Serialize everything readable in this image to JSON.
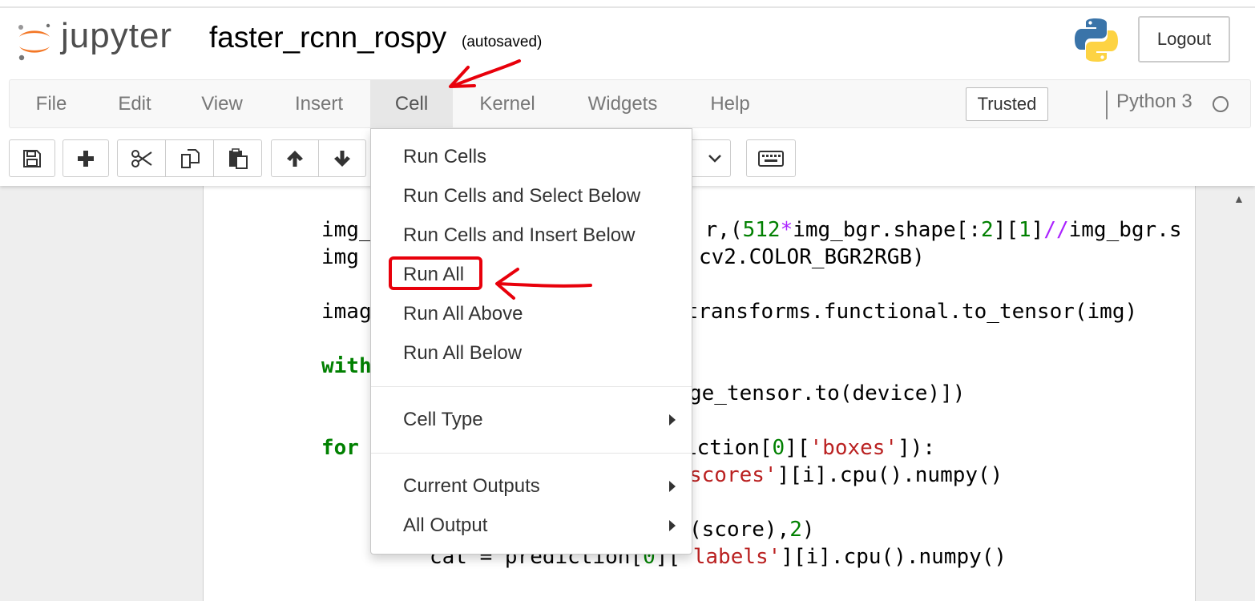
{
  "header": {
    "logo_text": "jupyter",
    "notebook_name": "faster_rcnn_rospy",
    "autosave_status": "(autosaved)",
    "logout_label": "Logout"
  },
  "menubar": {
    "file": "File",
    "edit": "Edit",
    "view": "View",
    "insert": "Insert",
    "cell": "Cell",
    "kernel": "Kernel",
    "widgets": "Widgets",
    "help": "Help"
  },
  "status": {
    "trusted": "Trusted",
    "kernel_name": "Python 3"
  },
  "toolbar": {
    "icons": [
      "save-icon",
      "plus-icon",
      "scissors-icon",
      "copy-icon",
      "paste-icon",
      "arrow-up-icon",
      "arrow-down-icon",
      "keyboard-icon"
    ]
  },
  "cell_menu": {
    "run_cells": "Run Cells",
    "run_cells_select_below": "Run Cells and Select Below",
    "run_cells_insert_below": "Run Cells and Insert Below",
    "run_all": "Run All",
    "run_all_above": "Run All Above",
    "run_all_below": "Run All Below",
    "cell_type": "Cell Type",
    "current_outputs": "Current Outputs",
    "all_output": "All Output"
  },
  "code": {
    "line2_a": "img_",
    "line2_b": "r,(",
    "line2_c": "512",
    "line2_d": "*",
    "line2_e": "img_bgr.shape[:",
    "line2_f": "2",
    "line2_g": "][",
    "line2_h": "1",
    "line2_i": "]",
    "line2_j": "//",
    "line2_k": "img_bgr.s",
    "line3_a": "img",
    "line3_b": "cv2.COLOR_BGR2RGB)",
    "line4_a": "imag",
    "line4_b": "transforms.functional.to_tensor(img)",
    "line5_kw": "with",
    "line6": "ge_tensor.to(device)])",
    "line7_kw": "for",
    "line7_a": "iction[",
    "line7_b": "0",
    "line7_c": "][",
    "line7_d": "'boxes'",
    "line7_e": "]):",
    "line8_a": "scores'",
    "line8_b": "][i].cpu().numpy()",
    "line9_a": "(score),",
    "line9_b": "2",
    "line9_c": ")",
    "line10_a": "cat = prediction[",
    "line10_b": "0",
    "line10_c": "][",
    "line10_d": "'labels'",
    "line10_e": "][i].cpu().numpy()"
  },
  "colors": {
    "keyword": "#008000",
    "operator": "#aa22ff",
    "string": "#ba2121",
    "annotation": "#e8000b",
    "jupyter_orange": "#f37726"
  }
}
